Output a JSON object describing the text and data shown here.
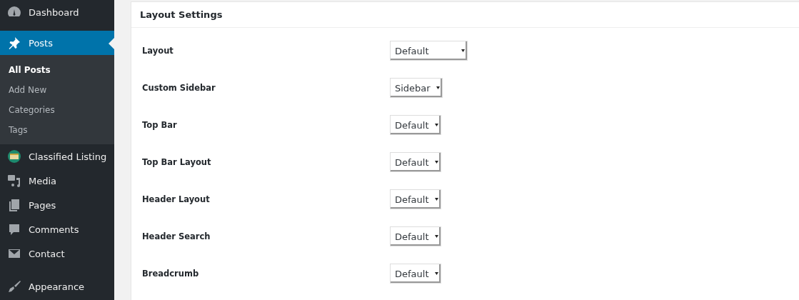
{
  "sidebar": {
    "items": [
      {
        "label": "Dashboard",
        "selected": false
      },
      {
        "label": "Posts",
        "selected": true,
        "children": [
          {
            "label": "All Posts",
            "selected": true
          },
          {
            "label": "Add New",
            "selected": false
          },
          {
            "label": "Categories",
            "selected": false
          },
          {
            "label": "Tags",
            "selected": false
          }
        ]
      },
      {
        "label": "Classified Listing",
        "selected": false
      },
      {
        "label": "Media",
        "selected": false
      },
      {
        "label": "Pages",
        "selected": false
      },
      {
        "label": "Comments",
        "selected": false
      },
      {
        "label": "Contact",
        "selected": false
      },
      {
        "label": "Appearance",
        "selected": false
      }
    ]
  },
  "panel": {
    "title": "Layout Settings",
    "fields": [
      {
        "label": "Layout",
        "value": "Default"
      },
      {
        "label": "Custom Sidebar",
        "value": "Sidebar"
      },
      {
        "label": "Top Bar",
        "value": "Default"
      },
      {
        "label": "Top Bar Layout",
        "value": "Default"
      },
      {
        "label": "Header Layout",
        "value": "Default"
      },
      {
        "label": "Header Search",
        "value": "Default"
      },
      {
        "label": "Breadcrumb",
        "value": "Default"
      }
    ]
  }
}
